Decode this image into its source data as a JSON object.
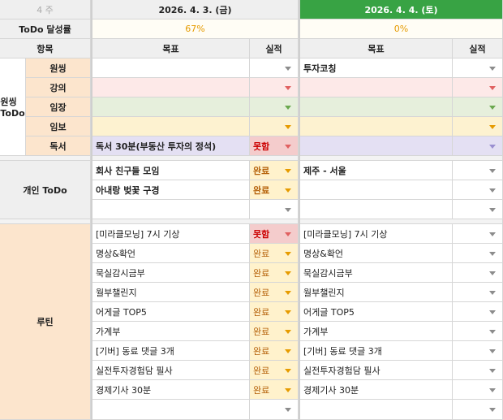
{
  "header": {
    "week_label": "4 주",
    "day1_date": "2026. 4. 3. (금)",
    "day2_date": "2026. 4. 4. (토)",
    "todo_rate_label": "ToDo 달성률",
    "day1_rate": "67%",
    "day2_rate": "0%",
    "col_item": "항목",
    "col_goal": "목표",
    "col_result": "실적"
  },
  "sections": {
    "wonsing_todo": "원씽\nToDo",
    "personal_todo": "개인 ToDo",
    "routine": "루틴"
  },
  "wonsing_rows": [
    {
      "label": "원씽",
      "goal1": "",
      "result1": "",
      "goal2": "투자코칭",
      "result2": ""
    },
    {
      "label": "강의",
      "goal1": "",
      "result1": "",
      "goal2": "",
      "result2": ""
    },
    {
      "label": "임장",
      "goal1": "",
      "result1": "",
      "goal2": "",
      "result2": ""
    },
    {
      "label": "임보",
      "goal1": "",
      "result1": "",
      "goal2": "",
      "result2": ""
    },
    {
      "label": "독서",
      "goal1": "독서 30분(부동산 투자의 정석)",
      "result1": "못함",
      "goal2": "",
      "result2": ""
    }
  ],
  "personal_rows": [
    {
      "goal1": "회사 친구들 모임",
      "result1": "완료",
      "goal2": "제주 - 서울",
      "result2": ""
    },
    {
      "goal1": "아내랑 벚꽃 구경",
      "result1": "완료",
      "goal2": "",
      "result2": ""
    },
    {
      "goal1": "",
      "result1": "",
      "goal2": "",
      "result2": ""
    }
  ],
  "routine_rows": [
    {
      "goal1": "[미라클모닝] 7시 기상",
      "result1": "못함",
      "goal2": "[미라클모닝] 7시 기상",
      "result2": ""
    },
    {
      "goal1": "명상&확언",
      "result1": "완료",
      "goal2": "명상&확언",
      "result2": ""
    },
    {
      "goal1": "묵실감시금부",
      "result1": "완료",
      "goal2": "묵실감시금부",
      "result2": ""
    },
    {
      "goal1": "월부챌린지",
      "result1": "완료",
      "goal2": "월부챌린지",
      "result2": ""
    },
    {
      "goal1": "어게글 TOP5",
      "result1": "완료",
      "goal2": "어게글 TOP5",
      "result2": ""
    },
    {
      "goal1": "가계부",
      "result1": "완료",
      "goal2": "가계부",
      "result2": ""
    },
    {
      "goal1": "[기버] 동료 댓글 3개",
      "result1": "완료",
      "goal2": "[기버] 동료 댓글 3개",
      "result2": ""
    },
    {
      "goal1": "실전투자경험담 필사",
      "result1": "완료",
      "goal2": "실전투자경험담 필사",
      "result2": ""
    },
    {
      "goal1": "경제기사 30분",
      "result1": "완료",
      "goal2": "경제기사 30분",
      "result2": ""
    },
    {
      "goal1": "",
      "result1": "",
      "goal2": "",
      "result2": ""
    }
  ],
  "colors": {
    "header_grey": "#efefef",
    "day2_header_green": "#38a344",
    "section_peach": "#fce5cd",
    "row_red": "#fde9e8",
    "row_green": "#e6efdc",
    "row_yellow": "#fdf2d0",
    "row_purple": "#e4e0f3",
    "status_bad_bg": "#f4cccc",
    "status_good_bg": "#fff2cc"
  }
}
